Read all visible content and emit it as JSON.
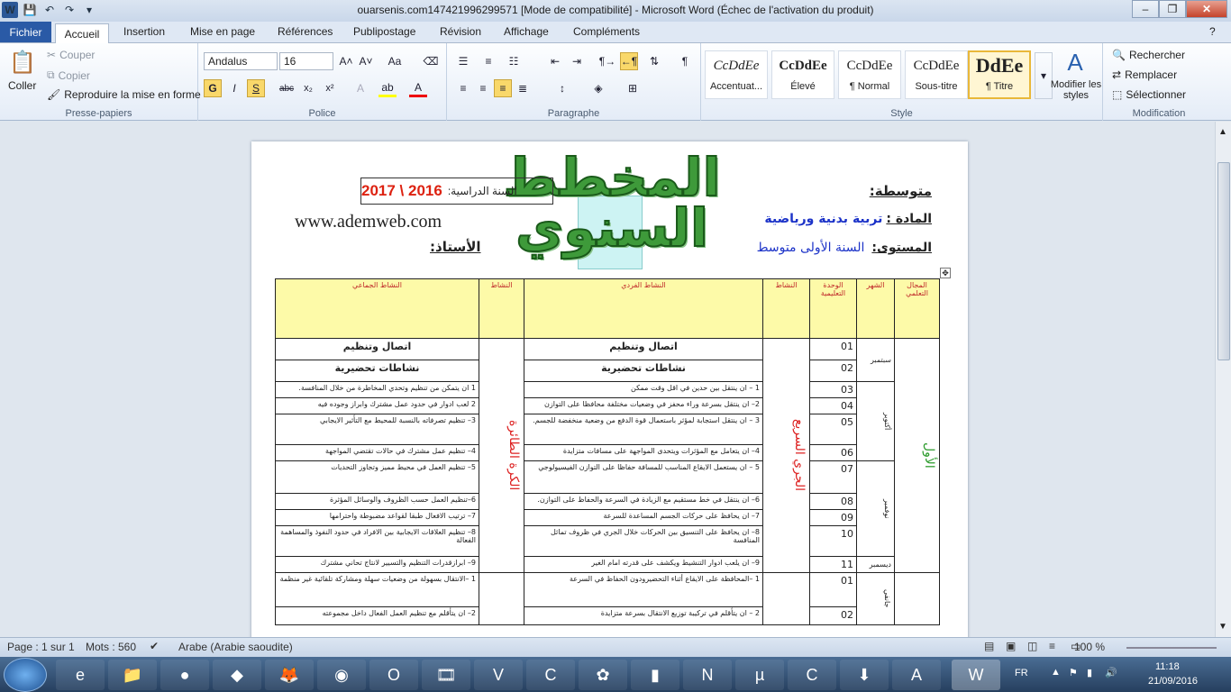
{
  "window": {
    "title": "ouarsenis.com147421996299571 [Mode de compatibilité]  -  Microsoft Word (Échec de l'activation du produit)"
  },
  "tabs": {
    "file": "Fichier",
    "items": [
      "Accueil",
      "Insertion",
      "Mise en page",
      "Références",
      "Publipostage",
      "Révision",
      "Affichage",
      "Compléments"
    ]
  },
  "clipboard": {
    "paste": "Coller",
    "cut": "Couper",
    "copy": "Copier",
    "format_painter": "Reproduire la mise en forme",
    "label": "Presse-papiers"
  },
  "font": {
    "name": "Andalus",
    "size": "16",
    "label": "Police"
  },
  "paragraph": {
    "label": "Paragraphe"
  },
  "styles": {
    "label": "Style",
    "items": [
      "Accentuat...",
      "Élevé",
      "¶ Normal",
      "Sous-titre",
      "¶ Titre"
    ],
    "samples": [
      "CcDdEe",
      "CcDdEe",
      "CcDdEe",
      "CcDdEe",
      "DdEe"
    ],
    "modify": "Modifier les styles"
  },
  "editing": {
    "label": "Modification",
    "find": "Rechercher",
    "replace": "Remplacer",
    "select": "Sélectionner"
  },
  "doc": {
    "title": "المخطط السنوي",
    "school": "متوسطة:",
    "subject_label": "المادة :",
    "subject": "تربية بدنية ورياضية",
    "level_label": "المستوى:",
    "level": "السنة الأولى متوسط",
    "year_label": "السنة الدراسية:",
    "year": "2017 \\ 2016",
    "website": "www.ademweb.com",
    "teacher": "الأستاذ:",
    "headers": [
      "المجال التعلمي",
      "الشهر",
      "الوحدة التعليمية",
      "النشاط",
      "النشاط الفردي",
      "النشاط",
      "النشاط الجماعي"
    ],
    "domain": "الأول",
    "ind_activity": "الجري السريع",
    "grp_activity": "الكرة الطائرة",
    "months": [
      "سبتمبر",
      "أكتوبر",
      "نوفمبر",
      "ديسمبر",
      "جانفي"
    ],
    "rows": [
      {
        "unit": "01",
        "ind": "اتصال وتنظيم",
        "grp": "اتصال وتنظيم"
      },
      {
        "unit": "02",
        "ind": "نشاطات تحضيرية",
        "grp": "نشاطات تحضيرية"
      },
      {
        "unit": "03",
        "ind": "1 – ان ينتقل بين حدين في اقل وقت ممكن",
        "grp": "1 ان يتمكن من تنظيم وتحدي المخاطرة  من خلال المنافسة."
      },
      {
        "unit": "04",
        "ind": "2– ان ينتقل بسرعة وراء محفز في وضعيات مختلفة محافظا على التوازن",
        "grp": "2 لعب ادوار في حدود عمل مشترك وابراز وجوده فيه"
      },
      {
        "unit": "05",
        "ind": "3 – ان ينتقل استجابة لمؤثر باستعمال قوة الدفع من وضعية منخفضة للجسم.",
        "grp": "3– تنظيم تصرفاته بالنسبة للمحيط مع التأثير الايجابي"
      },
      {
        "unit": "06",
        "ind": "4– ان يتعامل مع المؤثرات ويتحدى المواجهة على مسافات متزايدة",
        "grp": "4– تنظيم عمل مشترك في حالات تقتضي المواجهة"
      },
      {
        "unit": "07",
        "ind": "5 – ان يستعمل الايقاع المناسب للمسافة حفاظا على التوازن الفيسيولوجي",
        "grp": "5– تنظيم العمل في محيط مميز وتجاوز التحديات"
      },
      {
        "unit": "08",
        "ind": "6– ان ينتقل في خط مستقيم مع الزيادة في السرعة والحفاظ على التوازن.",
        "grp": "6–تنظيم العمل حسب الظروف والوسائل المؤثرة"
      },
      {
        "unit": "09",
        "ind": "7– ان يحافظ على حركات الجسم المساعدة للسرعة",
        "grp": "7– ترتيب الافعال طبقا لقواعد مضبوطة واحترامها"
      },
      {
        "unit": "10",
        "ind": "8– ان يحافظ على التنسيق بين الحركات خلال الجري في  ظروف تماثل المنافسة",
        "grp": "8– تنظيم العلاقات الايجابية بين الافراد في حدود النفوذ والمساهمة الفعالة"
      },
      {
        "unit": "11",
        "ind": "9– ان يلعب ادوار التنشيط  ويكشف على قدرته امام الغير",
        "grp": "9– ابرازقدرات التنظيم والتسيير لانتاج تحاني مشترك"
      },
      {
        "unit": "01",
        "ind": "1 –المحافظة على الايقاع أثناء التحضيرودون الحفاظ في السرعة",
        "grp": "1 –الانتقال بسهولة من وضعيات سهلة ومشاركة تلقائية غير منظمة"
      },
      {
        "unit": "02",
        "ind": "2 – ان يتأقلم في تركيبة توزيع الانتقال بسرعة متزايدة",
        "grp": "2– ان يتأقلم مع تنظيم العمل الفعال داخل مجموعته"
      }
    ]
  },
  "status": {
    "page": "Page : 1 sur 1",
    "words": "Mots : 560",
    "language": "Arabe (Arabie saoudite)",
    "zoom": "100 %"
  },
  "tray": {
    "lang": "FR",
    "time": "11:18",
    "date": "21/09/2016"
  }
}
